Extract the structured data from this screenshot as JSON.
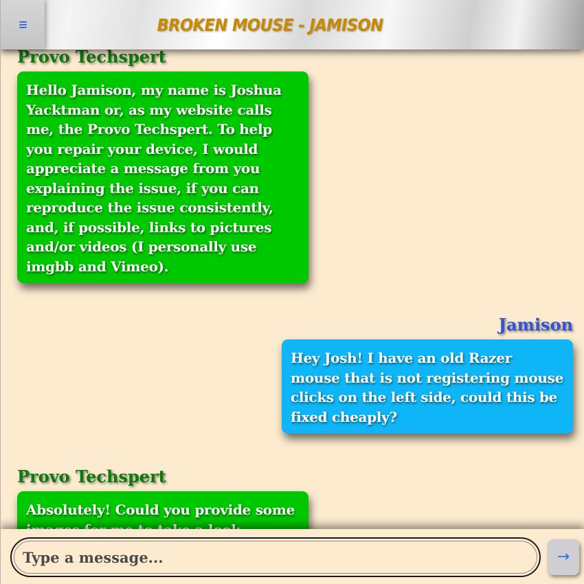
{
  "header": {
    "menu_icon": "hamburger-menu-icon",
    "title": "BROKEN MOUSE - JAMISON"
  },
  "messages": [
    {
      "sender": "Provo Techspert",
      "role": "support",
      "text": "Hello Jamison, my name is Joshua Yacktman or, as my website calls me, the Provo Techspert. To help you repair your device, I would appreciate a message from you explaining the issue, if you can reproduce the issue consistently, and, if possible, links to pictures and/or videos (I personally use imgbb and Vimeo)."
    },
    {
      "sender": "Jamison",
      "role": "user",
      "text": "Hey Josh! I have an old Razer mouse that is not registering mouse clicks on the left side, could this be fixed cheaply?"
    },
    {
      "sender": "Provo Techspert",
      "role": "support",
      "text": "Absolutely! Could you provide some images for me to take a look"
    }
  ],
  "composer": {
    "placeholder": "Type a message...",
    "value": "",
    "send_icon": "arrow-right-icon",
    "send_glyph": "→"
  },
  "colors": {
    "background": "#fdebd0",
    "support_bubble": "#00c800",
    "user_bubble": "#0fb6f7",
    "support_name": "#0a7a0a",
    "user_name": "#2f55d4",
    "title": "#c98a00",
    "accent": "#2f6fe0"
  }
}
